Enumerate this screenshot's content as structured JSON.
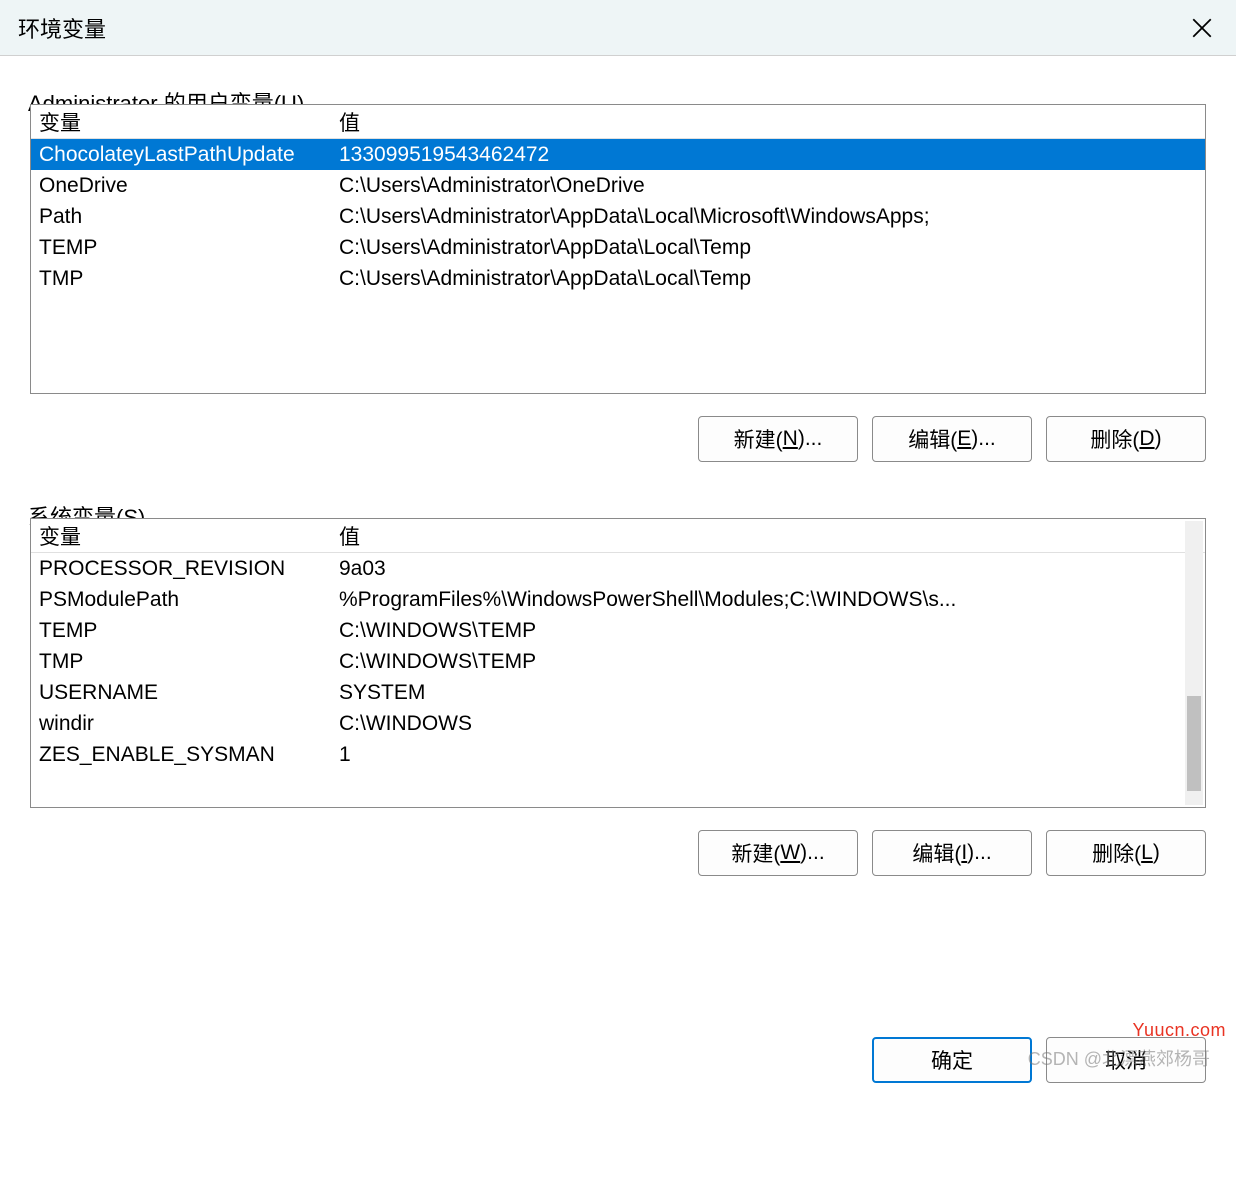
{
  "titlebar": {
    "title": "环境变量"
  },
  "user_section": {
    "legend_prefix": "Administrator 的用户变量(",
    "legend_hotkey": "U",
    "legend_suffix": ")",
    "headers": {
      "name": "变量",
      "value": "值"
    },
    "rows": [
      {
        "name": "ChocolateyLastPathUpdate",
        "value": "133099519543462472",
        "selected": true
      },
      {
        "name": "OneDrive",
        "value": "C:\\Users\\Administrator\\OneDrive"
      },
      {
        "name": "Path",
        "value": "C:\\Users\\Administrator\\AppData\\Local\\Microsoft\\WindowsApps;"
      },
      {
        "name": "TEMP",
        "value": "C:\\Users\\Administrator\\AppData\\Local\\Temp"
      },
      {
        "name": "TMP",
        "value": "C:\\Users\\Administrator\\AppData\\Local\\Temp"
      }
    ],
    "buttons": {
      "new": {
        "prefix": "新建(",
        "hotkey": "N",
        "suffix": ")..."
      },
      "edit": {
        "prefix": "编辑(",
        "hotkey": "E",
        "suffix": ")..."
      },
      "delete": {
        "prefix": "删除(",
        "hotkey": "D",
        "suffix": ")"
      }
    }
  },
  "system_section": {
    "legend_prefix": "系统变量(",
    "legend_hotkey": "S",
    "legend_suffix": ")",
    "headers": {
      "name": "变量",
      "value": "值"
    },
    "rows": [
      {
        "name": "PROCESSOR_REVISION",
        "value": "9a03"
      },
      {
        "name": "PSModulePath",
        "value": "%ProgramFiles%\\WindowsPowerShell\\Modules;C:\\WINDOWS\\s..."
      },
      {
        "name": "TEMP",
        "value": "C:\\WINDOWS\\TEMP"
      },
      {
        "name": "TMP",
        "value": "C:\\WINDOWS\\TEMP"
      },
      {
        "name": "USERNAME",
        "value": "SYSTEM"
      },
      {
        "name": "windir",
        "value": "C:\\WINDOWS"
      },
      {
        "name": "ZES_ENABLE_SYSMAN",
        "value": "1"
      }
    ],
    "buttons": {
      "new": {
        "prefix": "新建(",
        "hotkey": "W",
        "suffix": ")..."
      },
      "edit": {
        "prefix": "编辑(",
        "hotkey": "I",
        "suffix": ")..."
      },
      "delete": {
        "prefix": "删除(",
        "hotkey": "L",
        "suffix": ")"
      }
    }
  },
  "dialog_buttons": {
    "ok": "确定",
    "cancel": "取消"
  },
  "watermark": {
    "site": "Yuucn.com",
    "author": "CSDN @北漂燕郊杨哥"
  }
}
